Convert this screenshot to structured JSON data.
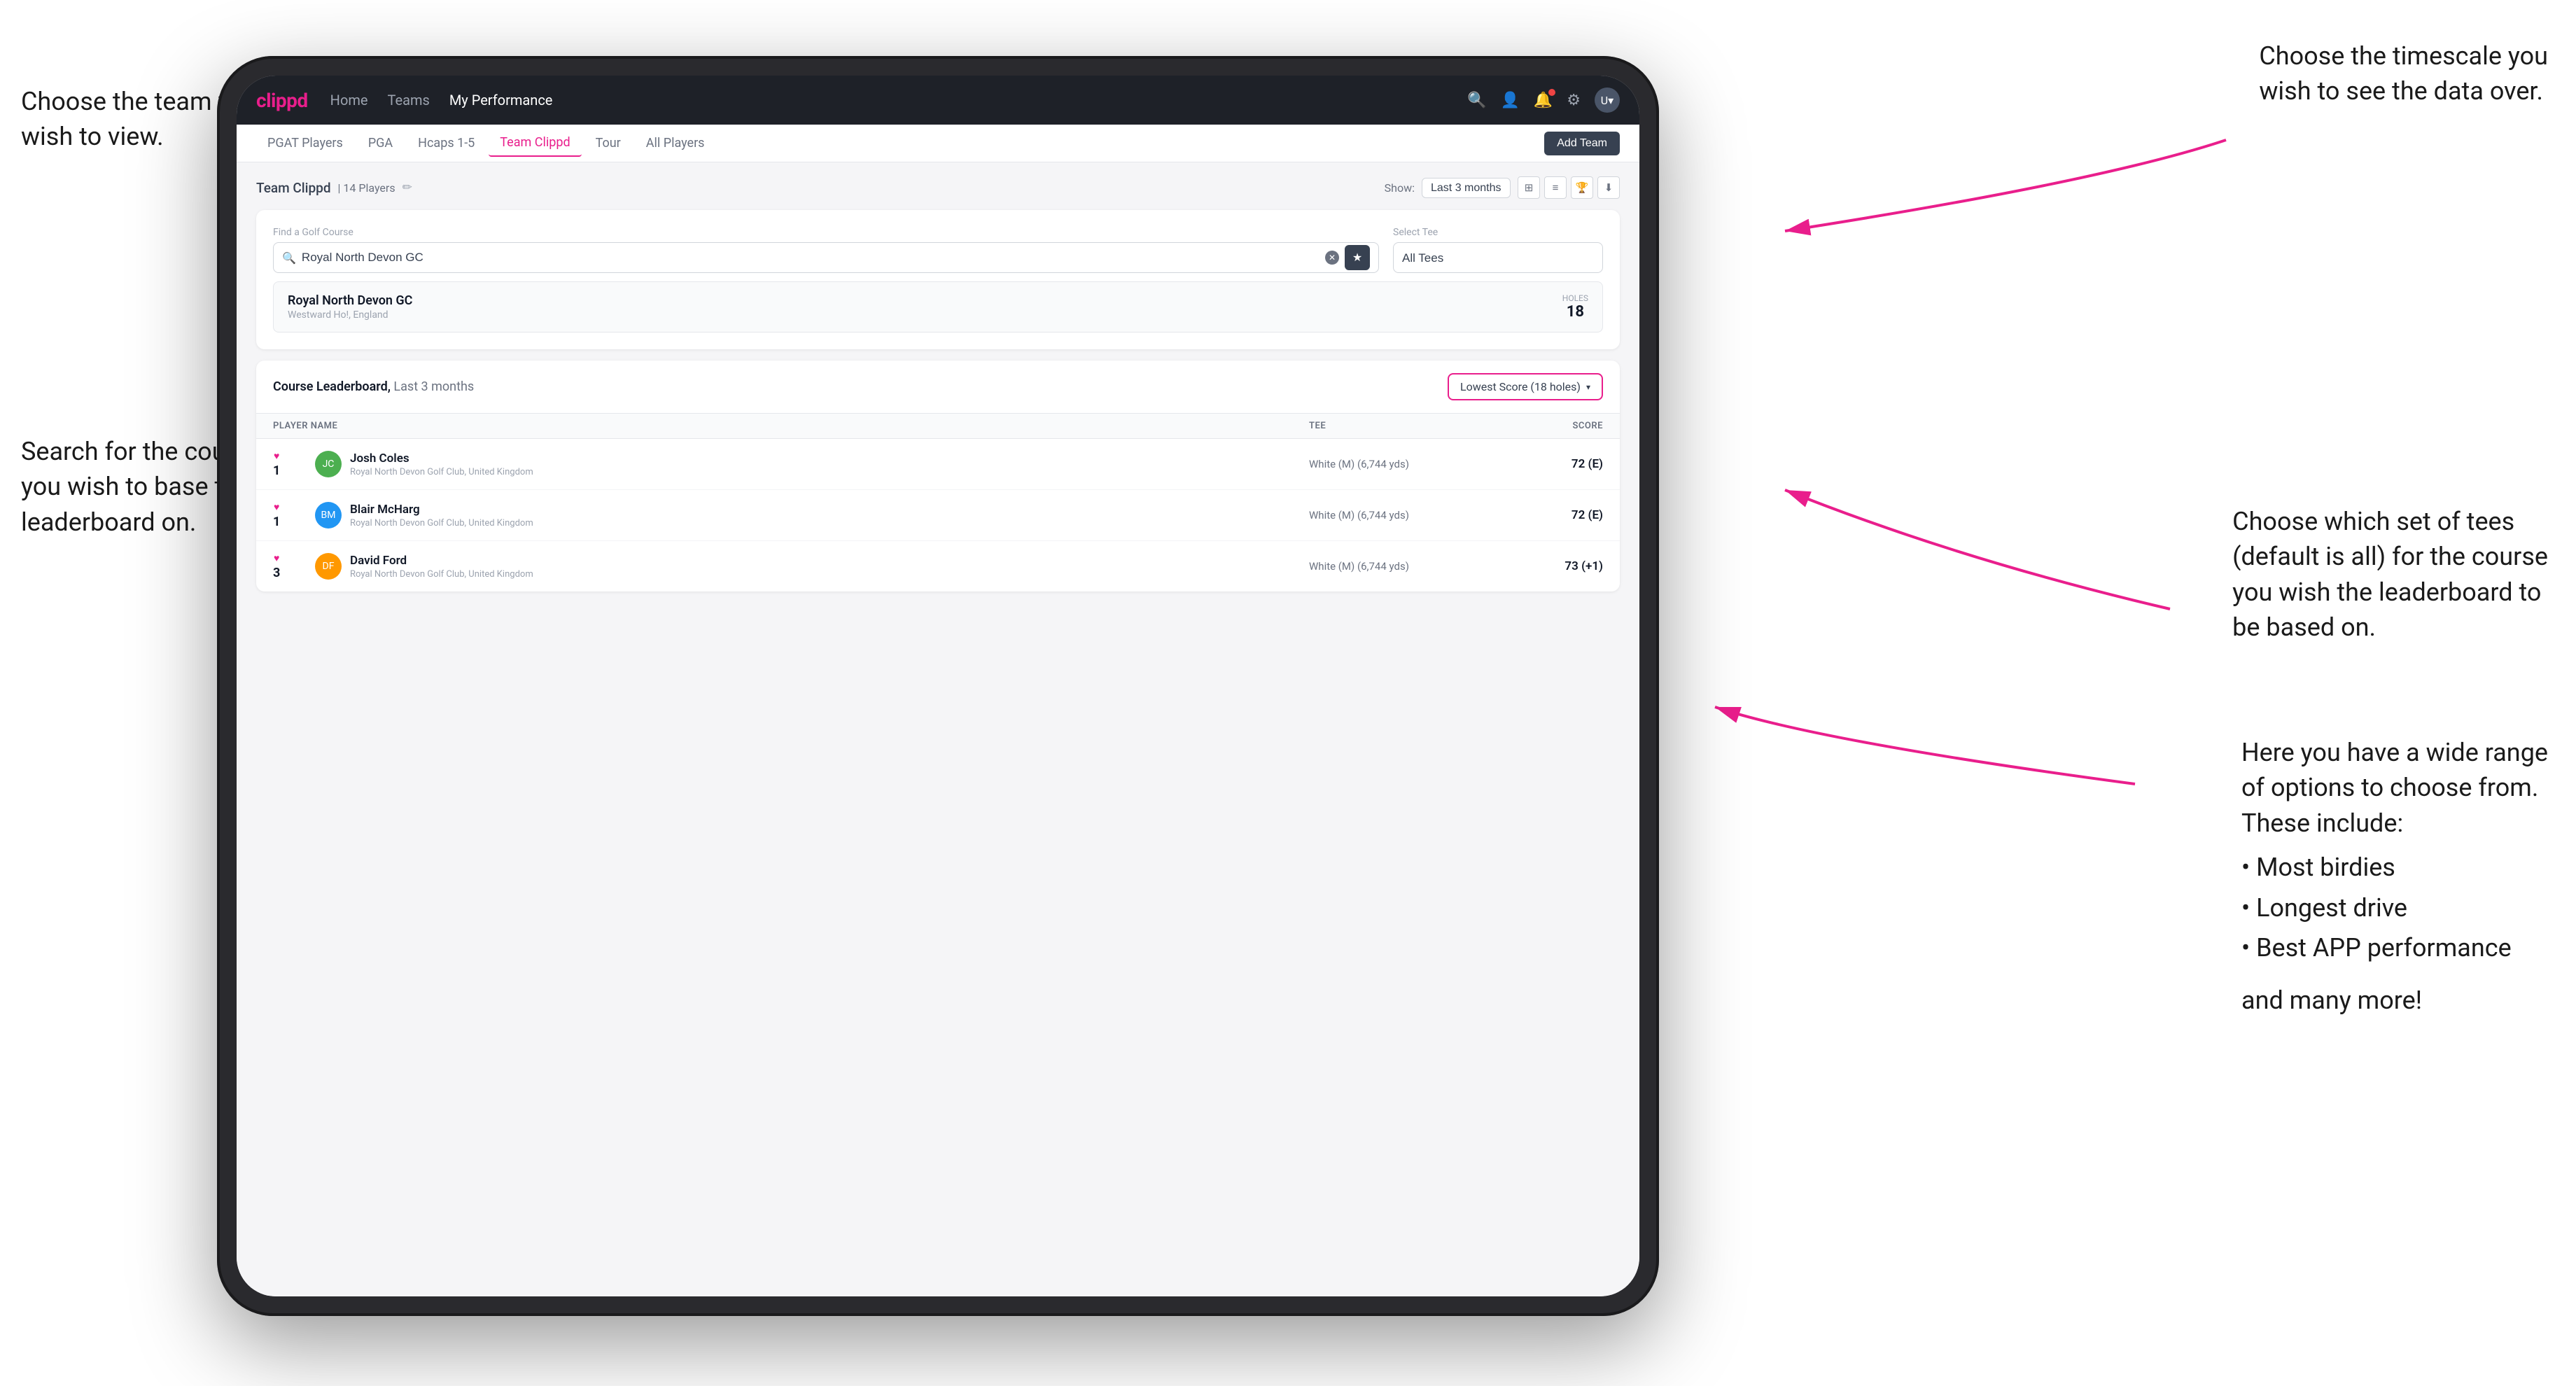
{
  "annotations": {
    "top_left": "Choose the team you\nwish to view.",
    "top_right": "Choose the timescale you\nwish to see the data over.",
    "mid_left": "Search for the course\nyou wish to base the\nleaderboard on.",
    "mid_right_title": "Choose which set of tees\n(default is all) for the course\nyou wish the leaderboard to\nbe based on.",
    "bottom_right_title": "Here you have a wide range\nof options to choose from.\nThese include:",
    "bullet_1": "Most birdies",
    "bullet_2": "Longest drive",
    "bullet_3": "Best APP performance",
    "and_more": "and many more!"
  },
  "navbar": {
    "logo": "clippd",
    "links": [
      "Home",
      "Teams",
      "My Performance"
    ],
    "active_link": "My Performance"
  },
  "sub_navbar": {
    "items": [
      "PGAT Players",
      "PGA",
      "Hcaps 1-5",
      "Team Clippd",
      "Tour",
      "All Players"
    ],
    "active": "Team Clippd",
    "add_team_label": "Add Team"
  },
  "team_header": {
    "title": "Team Clippd",
    "player_count": "14 Players",
    "show_label": "Show:",
    "show_value": "Last 3 months"
  },
  "search_section": {
    "find_course_label": "Find a Golf Course",
    "course_value": "Royal North Devon GC",
    "select_tee_label": "Select Tee",
    "tee_value": "All Tees",
    "course_result": {
      "name": "Royal North Devon GC",
      "location": "Westward Ho!, England",
      "holes_label": "Holes",
      "holes_value": "18"
    }
  },
  "leaderboard": {
    "title": "Course Leaderboard,",
    "period": "Last 3 months",
    "score_filter": "Lowest Score (18 holes)",
    "columns": [
      "PLAYER NAME",
      "TEE",
      "SCORE"
    ],
    "players": [
      {
        "rank": "1",
        "name": "Josh Coles",
        "club": "Royal North Devon Golf Club, United Kingdom",
        "tee": "White (M) (6,744 yds)",
        "score": "72 (E)",
        "avatar_color": "avatar-green"
      },
      {
        "rank": "1",
        "name": "Blair McHarg",
        "club": "Royal North Devon Golf Club, United Kingdom",
        "tee": "White (M) (6,744 yds)",
        "score": "72 (E)",
        "avatar_color": "avatar-blue"
      },
      {
        "rank": "3",
        "name": "David Ford",
        "club": "Royal North Devon Golf Club, United Kingdom",
        "tee": "White (M) (6,744 yds)",
        "score": "73 (+1)",
        "avatar_color": "avatar-orange"
      }
    ]
  }
}
